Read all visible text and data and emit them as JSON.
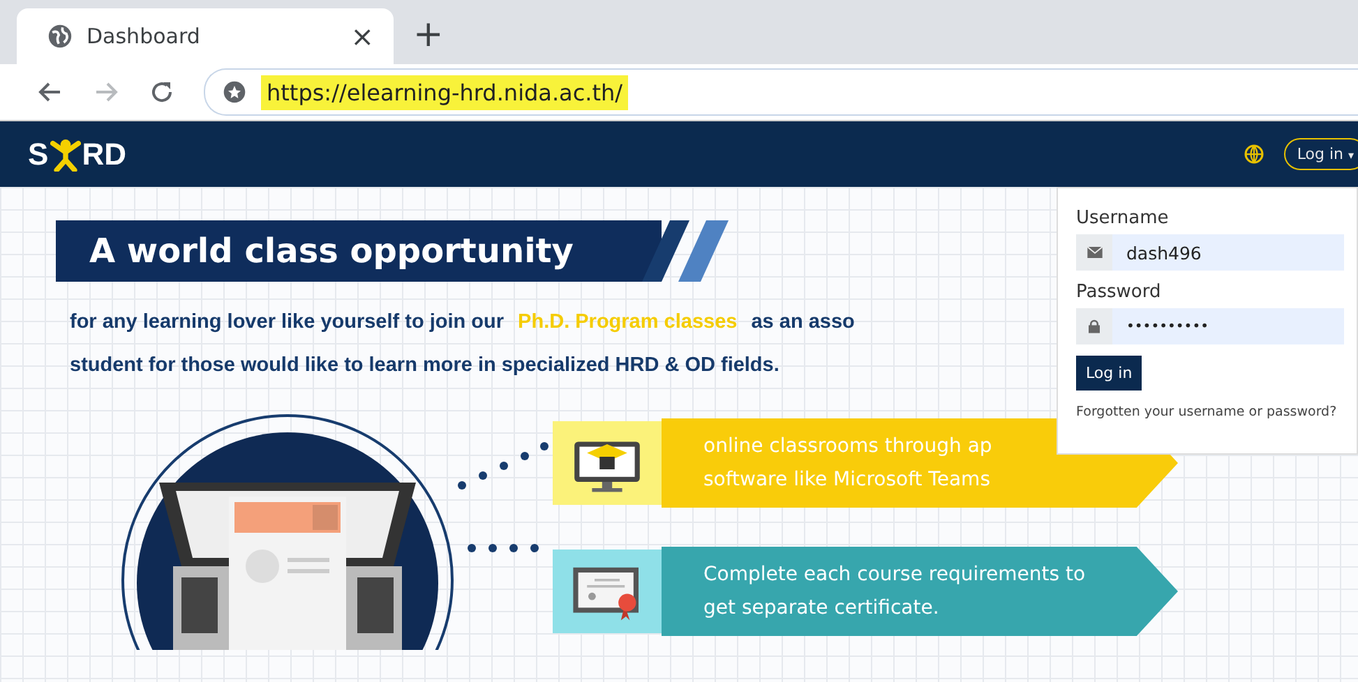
{
  "browser": {
    "tabs": [
      {
        "title": "Dashboard",
        "selected": true
      }
    ],
    "new_tab": "+",
    "close": "×",
    "url": "https://elearning-hrd.nida.ac.th/",
    "url_highlighted": true
  },
  "navbar": {
    "logo_left": "S",
    "logo_right": "RD",
    "login_button": "Log in",
    "login_caret": "▾"
  },
  "hero": {
    "title": "A world class opportunity",
    "line1_before": "for any learning lover like yourself to join  our",
    "line1_highlight": "Ph.D. Program classes",
    "line1_after": "as  an asso",
    "line2": "student  for those would like to learn more in specialized HRD & OD fields."
  },
  "features": [
    {
      "kind": "classroom",
      "color": "#f9cc0a",
      "lines": [
        "online classrooms through ap",
        "software like Microsoft Teams"
      ]
    },
    {
      "kind": "certificate",
      "color": "#37a6ad",
      "lines": [
        "Complete each course requirements to",
        "get separate certificate."
      ]
    }
  ],
  "login": {
    "username_label": "Username",
    "username": "dash496",
    "password_label": "Password",
    "password": "••••••••••",
    "submit": "Log in",
    "forgot": "Forgotten your username or password?"
  }
}
